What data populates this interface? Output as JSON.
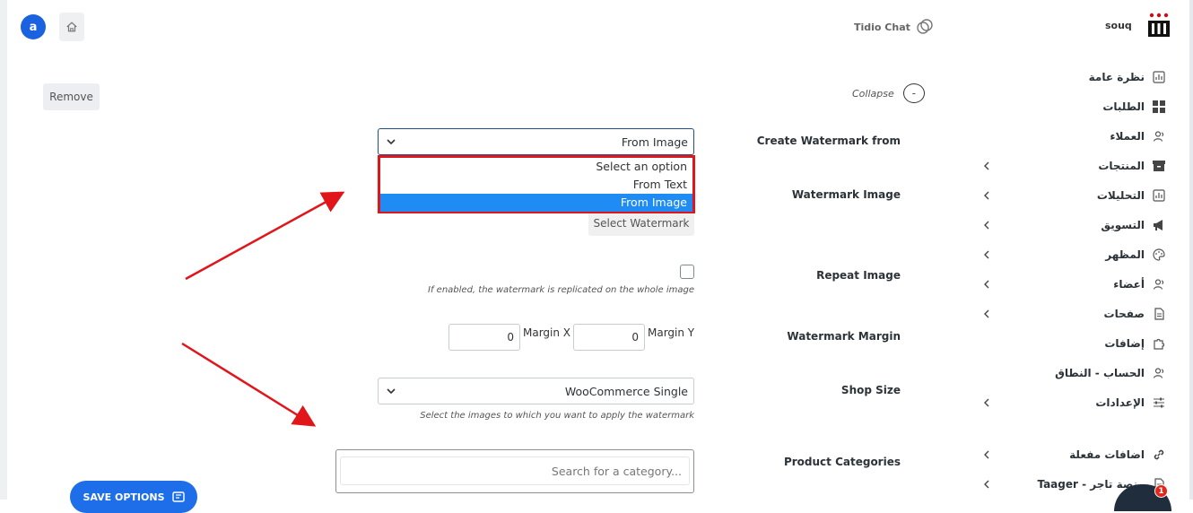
{
  "header": {
    "avatar_letter": "a",
    "tidio_label": "Tidio Chat",
    "brand_name": "souq"
  },
  "remove_label": "Remove",
  "collapse": {
    "label": "Collapse",
    "symbol": "-"
  },
  "fields": {
    "create_from": {
      "label": "Create Watermark from",
      "value": "From Image",
      "options": [
        "Select an option",
        "From Text",
        "From Image"
      ],
      "selected_index": 2
    },
    "watermark_image": {
      "label": "Watermark Image",
      "button_label": "Select Watermark"
    },
    "repeat_image": {
      "label": "Repeat Image",
      "checked": false,
      "help": "If enabled, the watermark is replicated on the whole image"
    },
    "watermark_margin": {
      "label": "Watermark Margin",
      "margin_x_label": "Margin X",
      "margin_x_value": "0",
      "margin_y_label": "Margin Y",
      "margin_y_value": "0"
    },
    "shop_size": {
      "label": "Shop Size",
      "value": "WooCommerce Single",
      "help": "Select the images to which you want to apply the watermark"
    },
    "product_categories": {
      "label": "Product Categories",
      "placeholder": "Search for a category..."
    }
  },
  "save_label": "SAVE OPTIONS",
  "sidebar": {
    "items": [
      {
        "label": "نظرة عامة",
        "icon": "chart-icon",
        "has_submenu": false
      },
      {
        "label": "الطلبات",
        "icon": "grid-icon",
        "has_submenu": false
      },
      {
        "label": "العملاء",
        "icon": "users-icon",
        "has_submenu": false
      },
      {
        "label": "المنتجات",
        "icon": "archive-icon",
        "has_submenu": true
      },
      {
        "label": "التحليلات",
        "icon": "chart-icon",
        "has_submenu": true
      },
      {
        "label": "التسويق",
        "icon": "megaphone-icon",
        "has_submenu": true
      },
      {
        "label": "المظهر",
        "icon": "palette-icon",
        "has_submenu": true
      },
      {
        "label": "أعضاء",
        "icon": "users-icon",
        "has_submenu": true
      },
      {
        "label": "صفحات",
        "icon": "page-icon",
        "has_submenu": true
      },
      {
        "label": "إضافات",
        "icon": "puzzle-icon",
        "has_submenu": false
      },
      {
        "label": "الحساب - النطاق",
        "icon": "users-icon",
        "has_submenu": false
      },
      {
        "label": "الإعدادات",
        "icon": "sliders-icon",
        "has_submenu": true
      },
      {
        "label": "اضافات مفعلة",
        "icon": "link-icon",
        "has_submenu": true
      },
      {
        "label": "Taager - منصة تاجر",
        "icon": "page-icon",
        "has_submenu": true
      }
    ]
  },
  "notification_count": "1",
  "colors": {
    "accent": "#1d6ee8",
    "selected_option": "#1e8cf3",
    "highlight_box": "#e0161b",
    "annotation_arrow": "#e0161b"
  }
}
